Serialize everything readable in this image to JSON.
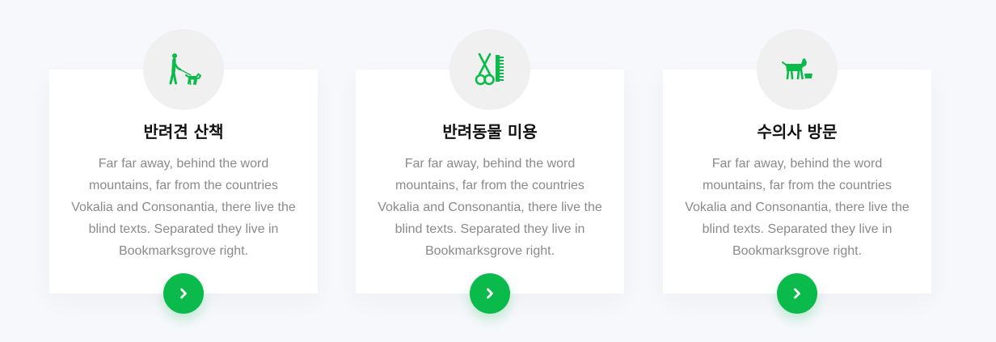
{
  "colors": {
    "accent": "#0abb4c",
    "card_background": "#ffffff",
    "page_background": "#f7f8fc",
    "icon_circle": "#f0f0f0",
    "title": "#111111",
    "body_text": "#8a8a8a"
  },
  "services": [
    {
      "icon": "dog-walking-icon",
      "title": "반려견 산책",
      "text": "Far far away, behind the word mountains, far from the countries Vokalia and Consonantia, there live the blind texts. Separated they live in Bookmarksgrove right.",
      "button_icon": "chevron-right-icon"
    },
    {
      "icon": "grooming-scissors-comb-icon",
      "title": "반려동물 미용",
      "text": "Far far away, behind the word mountains, far from the countries Vokalia and Consonantia, there live the blind texts. Separated they live in Bookmarksgrove right.",
      "button_icon": "chevron-right-icon"
    },
    {
      "icon": "dog-with-food-bowl-icon",
      "title": "수의사 방문",
      "text": "Far far away, behind the word mountains, far from the countries Vokalia and Consonantia, there live the blind texts. Separated they live in Bookmarksgrove right.",
      "button_icon": "chevron-right-icon"
    }
  ]
}
